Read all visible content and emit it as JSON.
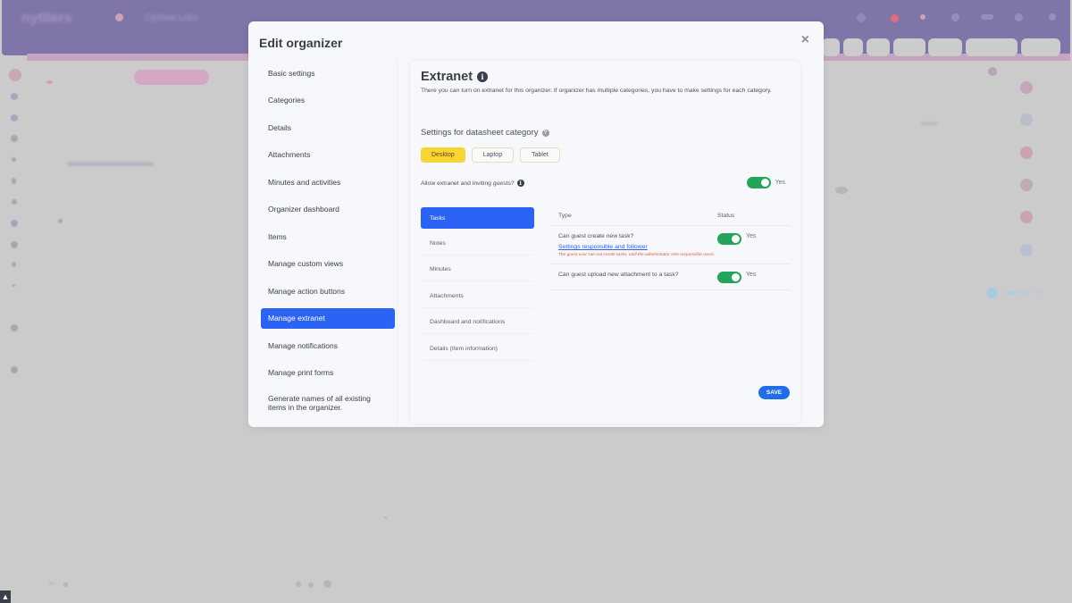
{
  "background": {
    "app_logo": "nytllers",
    "workspace_name": "Ophise Lalu",
    "accent_topbar": "#8075a8"
  },
  "modal": {
    "title": "Edit organizer",
    "close_icon": "×",
    "side_nav": [
      {
        "label": "Basic settings",
        "active": false
      },
      {
        "label": "Categories",
        "active": false
      },
      {
        "label": "Details",
        "active": false
      },
      {
        "label": "Attachments",
        "active": false
      },
      {
        "label": "Minutes and activities",
        "active": false
      },
      {
        "label": "Organizer dashboard",
        "active": false
      },
      {
        "label": "Items",
        "active": false
      },
      {
        "label": "Manage custom views",
        "active": false
      },
      {
        "label": "Manage action buttons",
        "active": false
      },
      {
        "label": "Manage extranet",
        "active": true
      },
      {
        "label": "Manage notifications",
        "active": false
      },
      {
        "label": "Manage print forms",
        "active": false
      },
      {
        "label": "Generate names of all existing items in the organizer.",
        "active": false
      }
    ],
    "panel": {
      "title": "Extranet",
      "info_icon": "i",
      "description": "There you can turn on extranet for this organizer. If organizer has multiple categories, you have to make settings for each category.",
      "section_title": "Settings for datasheet category",
      "help_icon": "?",
      "device_tabs": [
        {
          "label": "Desktop",
          "active": true
        },
        {
          "label": "Laptop",
          "active": false
        },
        {
          "label": "Tablet",
          "active": false
        }
      ],
      "allow_label": "Allow extranet and inviting guests?",
      "allow_toggle": {
        "on": true,
        "label": "Yes"
      },
      "sub_nav": [
        {
          "label": "Tasks",
          "active": true
        },
        {
          "label": "Notes",
          "active": false
        },
        {
          "label": "Minutes",
          "active": false
        },
        {
          "label": "Attachments",
          "active": false
        },
        {
          "label": "Dashboard and notifications",
          "active": false
        },
        {
          "label": "Details (Item information)",
          "active": false
        }
      ],
      "table": {
        "headers": {
          "type": "Type",
          "status": "Status"
        },
        "rows": [
          {
            "type": "Can guest create new task?",
            "link": "Settings responsible and follower",
            "warning": "The guest user can not create tasks, until the administrator sets responsible users.",
            "toggle_on": true,
            "status_label": "Yes"
          },
          {
            "type": "Can guest upload new attachment to a task?",
            "toggle_on": true,
            "status_label": "Yes"
          }
        ]
      },
      "save_label": "SAVE"
    }
  }
}
